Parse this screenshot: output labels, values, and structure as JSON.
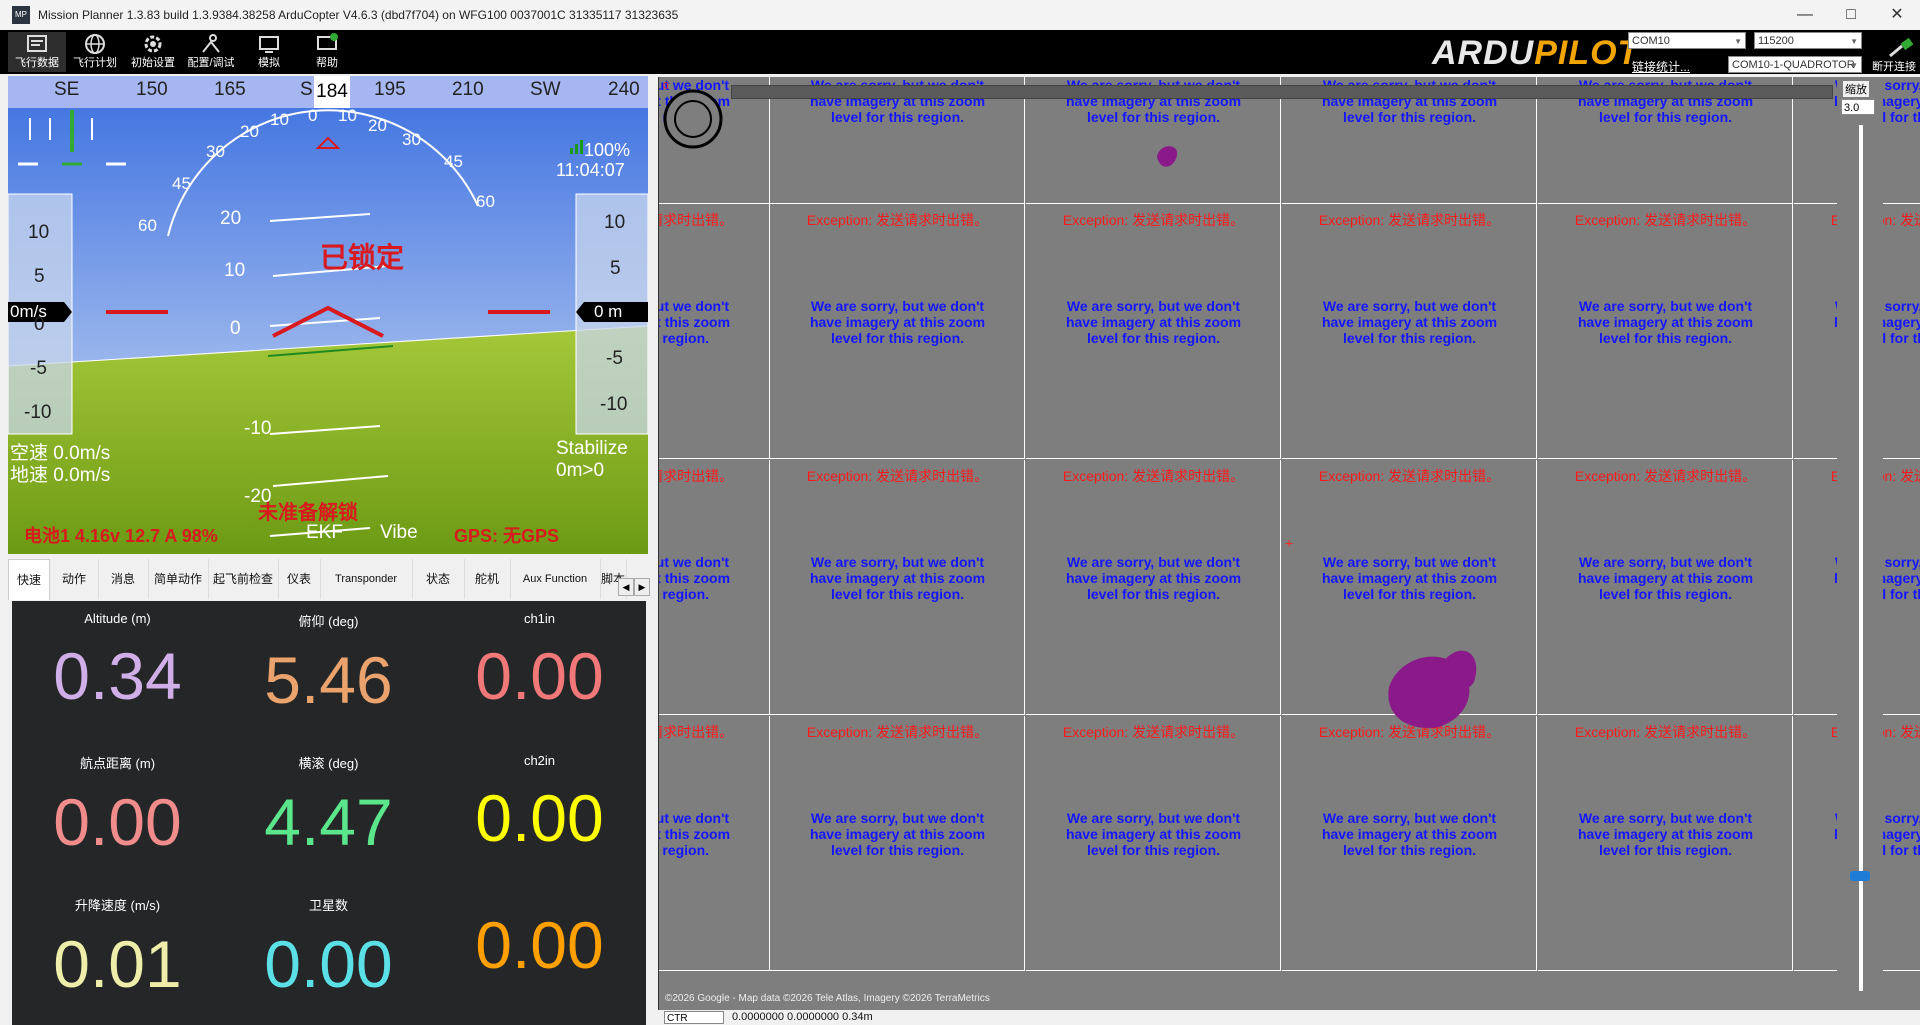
{
  "window": {
    "title": "Mission Planner 1.3.83 build 1.3.9384.38258 ArduCopter V4.6.3 (dbd7f704) on WFG100 0037001C 31335117 31323635",
    "icon_text": "MP"
  },
  "toolbar": {
    "items": [
      {
        "label": "飞行数据",
        "icon": "flight-data-icon"
      },
      {
        "label": "飞行计划",
        "icon": "globe-icon"
      },
      {
        "label": "初始设置",
        "icon": "setup-icon"
      },
      {
        "label": "配置/调试",
        "icon": "config-icon"
      },
      {
        "label": "模拟",
        "icon": "simulation-icon"
      },
      {
        "label": "帮助",
        "icon": "help-icon"
      }
    ],
    "logo_left": "ARDU",
    "logo_right": "PILOT",
    "port": "COM10",
    "baud": "115200",
    "link_stats": "链接统计...",
    "vehicle": "COM10-1-QUADROTOR",
    "connect_label": "断开连接"
  },
  "hud": {
    "heading_labels": [
      "SE",
      "150",
      "165",
      "S",
      "195",
      "210",
      "SW",
      "240"
    ],
    "heading_value": "184",
    "roll_scale": [
      "60",
      "45",
      "30",
      "20",
      "10",
      "0",
      "10",
      "20",
      "30",
      "45",
      "60"
    ],
    "pitch_scale": [
      "20",
      "10",
      "0",
      "-10",
      "-20"
    ],
    "speed_scale": [
      "10",
      "5",
      "0",
      "-5",
      "-10"
    ],
    "alt_scale": [
      "10",
      "5",
      "-5",
      "-10"
    ],
    "speed_box": "0m/s",
    "alt_box": "0 m",
    "battery_percent_signal": "100%",
    "time": "11:04:07",
    "armed_status": "已锁定",
    "airspeed": "空速 0.0m/s",
    "groundspeed": "地速 0.0m/s",
    "mode": "Stabilize",
    "distance": "0m>0",
    "prearm": "未准备解锁",
    "battery": "电池1 4.16v 12.7 A 98%",
    "ekf": "EKF",
    "vibe": "Vibe",
    "gps": "GPS: 无GPS",
    "colors": {
      "sky": "#3e7be5",
      "ground": "#86b820",
      "hud_red": "#d8191e"
    }
  },
  "tabs": [
    "快速",
    "动作",
    "消息",
    "简单动作",
    "起飞前检查",
    "仪表",
    "Transponder",
    "状态",
    "舵机",
    "Aux Function",
    "脚本"
  ],
  "active_tab": 0,
  "quick": {
    "cells": [
      {
        "label": "Altitude (m)",
        "value": "0.34",
        "color": "#d0aee8"
      },
      {
        "label": "俯仰 (deg)",
        "value": "5.46",
        "color": "#eaa36c"
      },
      {
        "label": "ch1in",
        "value": "0.00",
        "color": "#f07878"
      },
      {
        "label": "航点距离 (m)",
        "value": "0.00",
        "color": "#f08c8c"
      },
      {
        "label": "横滚 (deg)",
        "value": "4.47",
        "color": "#5be68c"
      },
      {
        "label": "ch2in",
        "value": "0.00",
        "color": "#ffff00"
      },
      {
        "label": "升降速度 (m/s)",
        "value": "0.01",
        "color": "#eeeeaa"
      },
      {
        "label": "卫星数",
        "value": "0.00",
        "color": "#5ae0e6"
      },
      {
        "label": "",
        "value": "0.00",
        "color": "#ffa000"
      }
    ]
  },
  "map": {
    "exception_text": "Exception: 发送请求时出错。",
    "sorry_lines": [
      "We are sorry, but we don't",
      "have imagery at this zoom",
      "level for this region."
    ],
    "zoom_label": "缩放",
    "zoom_value": "3.0",
    "copyright": "©2026 Google - Map data ©2026 Tele Atlas, Imagery ©2026 TerraMetrics",
    "coords": "0.0000000 0.0000000    0.34m",
    "alt_mode": "CTR",
    "slider_marker": "0"
  }
}
